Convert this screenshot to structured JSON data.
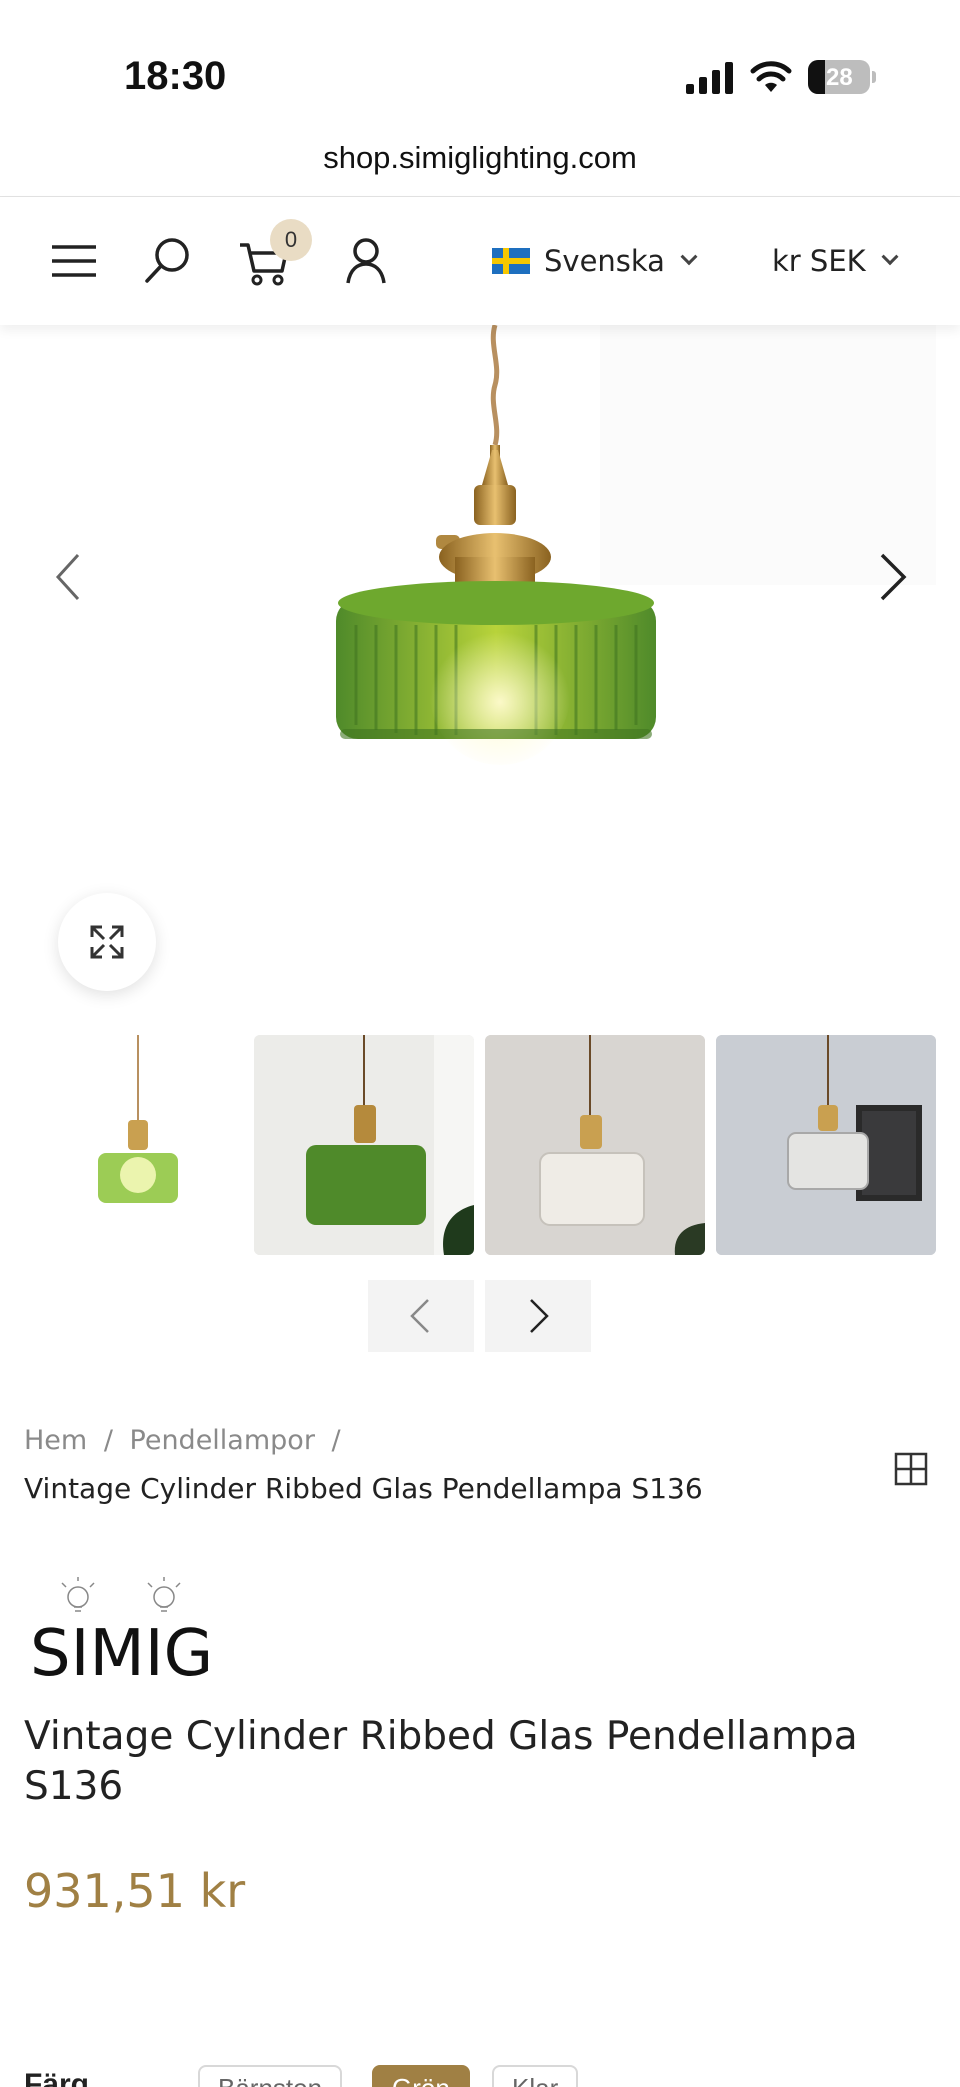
{
  "status_bar": {
    "time": "18:30",
    "battery": "28",
    "battery_level": 0.28
  },
  "browser": {
    "url": "shop.simiglighting.com"
  },
  "header": {
    "cart_count": "0",
    "language": "Svenska",
    "currency": "kr SEK",
    "icons": [
      "menu-icon",
      "search-icon",
      "cart-icon",
      "account-icon"
    ]
  },
  "gallery": {
    "thumbnail_count": 4
  },
  "breadcrumb": {
    "items": [
      "Hem",
      "Pendellampor"
    ],
    "separator": "/",
    "current": "Vintage Cylinder Ribbed Glas Pendellampa S136"
  },
  "brand": {
    "name": "SIMIG"
  },
  "product": {
    "title": "Vintage Cylinder Ribbed Glas Pendellampa S136",
    "price": "931,51 kr"
  },
  "options": {
    "label": "Färg",
    "values": [
      "Bärnsten",
      "Grön",
      "Klar"
    ],
    "selected_index": 1
  },
  "colors": {
    "accent": "#a08044",
    "badge": "#e9dcc4",
    "glass_green": "#5a9a2c"
  }
}
